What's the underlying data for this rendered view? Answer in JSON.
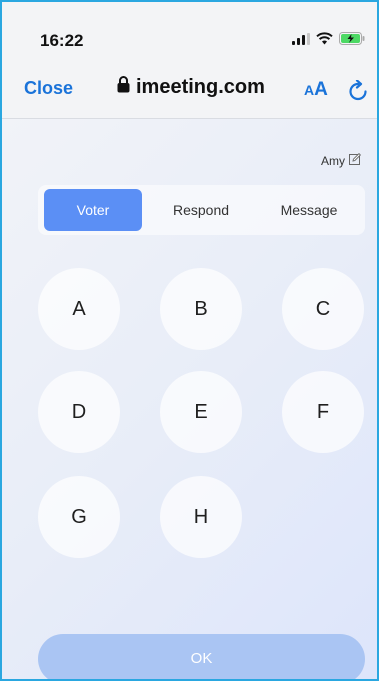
{
  "statusbar": {
    "time": "16:22"
  },
  "browser": {
    "close_label": "Close",
    "url": "imeeting.com",
    "text_size_small": "A",
    "text_size_big": "A"
  },
  "user": {
    "name": "Amy"
  },
  "tabs": [
    {
      "label": "Voter",
      "active": true
    },
    {
      "label": "Respond",
      "active": false
    },
    {
      "label": "Message",
      "active": false
    }
  ],
  "options": [
    "A",
    "B",
    "C",
    "D",
    "E",
    "F",
    "G",
    "H"
  ],
  "ok_label": "OK",
  "colors": {
    "accent": "#5b8ff5",
    "link": "#1a73d9",
    "ok_button": "#aac5f3",
    "frame_border": "#2aa7e0"
  }
}
